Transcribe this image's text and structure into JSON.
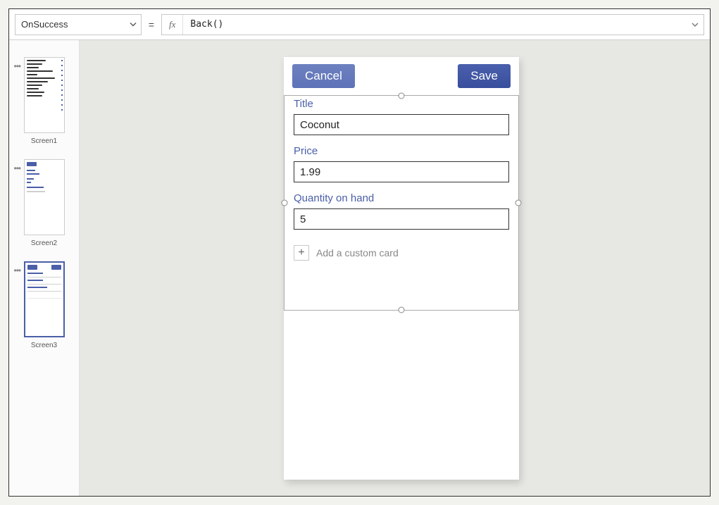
{
  "formula_bar": {
    "property": "OnSuccess",
    "fx_label": "fx",
    "expression": "Back()"
  },
  "screens_panel": {
    "items": [
      {
        "label": "Screen1"
      },
      {
        "label": "Screen2"
      },
      {
        "label": "Screen3"
      }
    ]
  },
  "phone_app": {
    "header": {
      "cancel_label": "Cancel",
      "save_label": "Save"
    },
    "fields": {
      "title": {
        "label": "Title",
        "value": "Coconut"
      },
      "price": {
        "label": "Price",
        "value": "1.99"
      },
      "qty": {
        "label": "Quantity on hand",
        "value": "5"
      }
    },
    "add_card_label": "Add a custom card",
    "plus_glyph": "+"
  },
  "icons": {
    "equals": "="
  }
}
